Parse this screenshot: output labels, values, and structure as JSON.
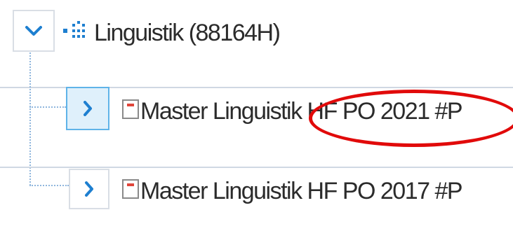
{
  "tree": {
    "root": {
      "label": "Linguistik (88164H)",
      "expanded": true,
      "toggle_icon": "chevron-down-icon",
      "node_icon": "org-unit-icon"
    },
    "children": [
      {
        "label": "Master Linguistik HF PO 2021 #P",
        "selected": true,
        "toggle_icon": "chevron-right-icon",
        "node_icon": "document-icon"
      },
      {
        "label": "Master Linguistik HF PO 2017 #P",
        "selected": false,
        "toggle_icon": "chevron-right-icon",
        "node_icon": "document-icon"
      }
    ]
  },
  "colors": {
    "chevron": "#1e7fd0",
    "selected_bg": "#dff0fb",
    "selected_border": "#5fb3e8",
    "document_mark": "#e0453a",
    "annotation": "#e10a0a"
  }
}
